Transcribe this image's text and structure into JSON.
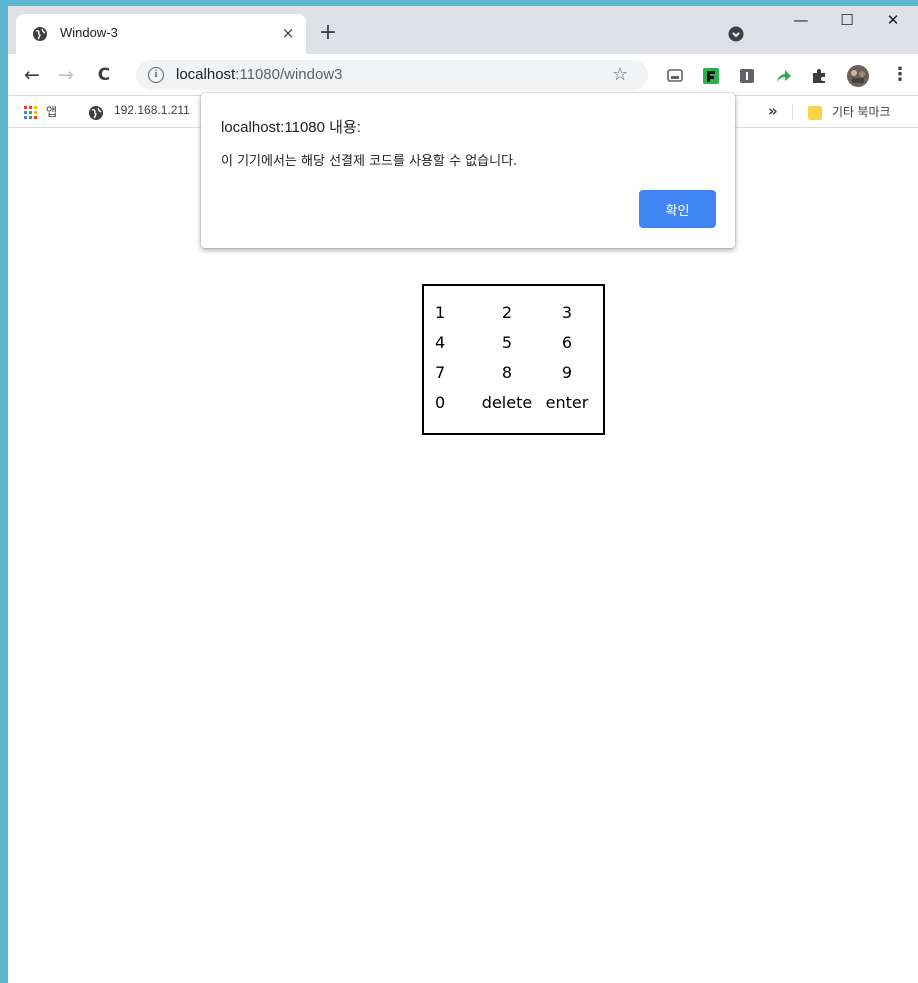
{
  "browser": {
    "tab": {
      "title": "Window-3",
      "close": "×",
      "favicon": "globe-icon"
    },
    "new_tab": "+",
    "window_controls": {
      "minimize": "—",
      "maximize": "☐",
      "close": "✕"
    },
    "nav": {
      "back": "←",
      "forward": "→",
      "reload": "C"
    },
    "omnibox": {
      "host": "localhost",
      "rest": ":11080/window3",
      "info": "i"
    },
    "bookmark_star": "☆",
    "menu": "⋮",
    "extensions": [
      "cast-icon",
      "feedly-icon",
      "reader-icon",
      "share-icon",
      "puzzle-icon",
      "avatar"
    ],
    "accent": "#4285f4"
  },
  "bookmarks": {
    "apps_label": "앱",
    "ip_label": "192.168.1.211",
    "more": "»",
    "other_label": "기타 북마크"
  },
  "dialog": {
    "title": "localhost:11080 내용:",
    "message": "이 기기에서는 해당 선결제 코드를 사용할 수 없습니다.",
    "ok_label": "확인"
  },
  "keypad": {
    "rows": [
      [
        "1",
        "2",
        "3"
      ],
      [
        "4",
        "5",
        "6"
      ],
      [
        "7",
        "8",
        "9"
      ],
      [
        "0",
        "delete",
        "enter"
      ]
    ]
  }
}
